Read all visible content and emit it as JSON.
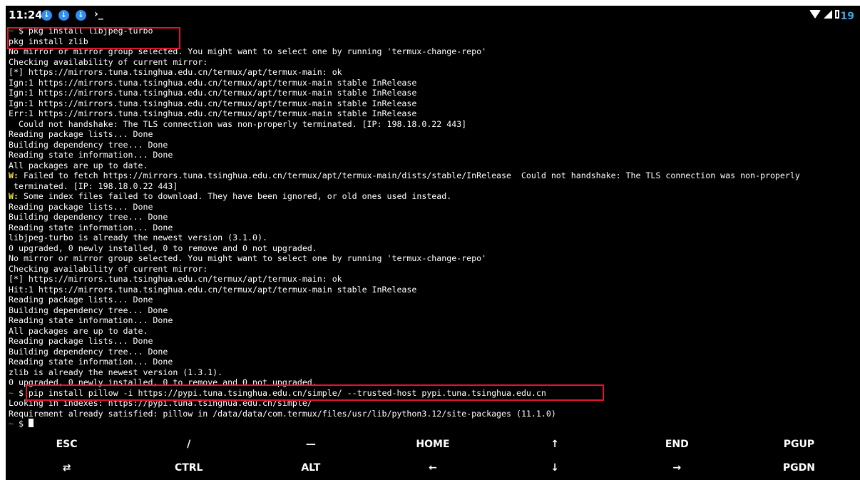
{
  "status_bar": {
    "time": "11:24",
    "notification_icons": [
      "download-icon",
      "download-icon",
      "download-icon"
    ],
    "terminal_glyph": "›_",
    "battery_level": "19",
    "colors": {
      "notif": "#2f8ff2",
      "battery_text": "#39a8e0"
    }
  },
  "terminal": {
    "lines": [
      {
        "prefix": "~ ",
        "text": "$ pkg install libjpeg-turbo"
      },
      {
        "text": "pkg install zlib"
      },
      {
        "text": "No mirror or mirror group selected. You might want to select one by running 'termux-change-repo'"
      },
      {
        "text": "Checking availability of current mirror:"
      },
      {
        "text": "[*] https://mirrors.tuna.tsinghua.edu.cn/termux/apt/termux-main: ok"
      },
      {
        "text": "Ign:1 https://mirrors.tuna.tsinghua.edu.cn/termux/apt/termux-main stable InRelease"
      },
      {
        "text": "Ign:1 https://mirrors.tuna.tsinghua.edu.cn/termux/apt/termux-main stable InRelease"
      },
      {
        "text": "Ign:1 https://mirrors.tuna.tsinghua.edu.cn/termux/apt/termux-main stable InRelease"
      },
      {
        "text": "Err:1 https://mirrors.tuna.tsinghua.edu.cn/termux/apt/termux-main stable InRelease"
      },
      {
        "text": "  Could not handshake: The TLS connection was non-properly terminated. [IP: 198.18.0.22 443]"
      },
      {
        "text": "Reading package lists... Done"
      },
      {
        "text": "Building dependency tree... Done"
      },
      {
        "text": "Reading state information... Done"
      },
      {
        "text": "All packages are up to date."
      },
      {
        "warn": "W:",
        "text": " Failed to fetch https://mirrors.tuna.tsinghua.edu.cn/termux/apt/termux-main/dists/stable/InRelease  Could not handshake: The TLS connection was non-properly"
      },
      {
        "text": " terminated. [IP: 198.18.0.22 443]"
      },
      {
        "warn": "W:",
        "text": " Some index files failed to download. They have been ignored, or old ones used instead."
      },
      {
        "text": "Reading package lists... Done"
      },
      {
        "text": "Building dependency tree... Done"
      },
      {
        "text": "Reading state information... Done"
      },
      {
        "text": "libjpeg-turbo is already the newest version (3.1.0)."
      },
      {
        "text": "0 upgraded, 0 newly installed, 0 to remove and 0 not upgraded."
      },
      {
        "text": "No mirror or mirror group selected. You might want to select one by running 'termux-change-repo'"
      },
      {
        "text": "Checking availability of current mirror:"
      },
      {
        "text": "[*] https://mirrors.tuna.tsinghua.edu.cn/termux/apt/termux-main: ok"
      },
      {
        "text": "Hit:1 https://mirrors.tuna.tsinghua.edu.cn/termux/apt/termux-main stable InRelease"
      },
      {
        "text": "Reading package lists... Done"
      },
      {
        "text": "Building dependency tree... Done"
      },
      {
        "text": "Reading state information... Done"
      },
      {
        "text": "All packages are up to date."
      },
      {
        "text": "Reading package lists... Done"
      },
      {
        "text": "Building dependency tree... Done"
      },
      {
        "text": "Reading state information... Done"
      },
      {
        "text": "zlib is already the newest version (1.3.1)."
      },
      {
        "text": "0 upgraded, 0 newly installed, 0 to remove and 0 not upgraded."
      },
      {
        "prefix": "~ ",
        "text": "$ pip install pillow -i https://pypi.tuna.tsinghua.edu.cn/simple/ --trusted-host pypi.tuna.tsinghua.edu.cn"
      },
      {
        "text": "Looking in indexes: https://pypi.tuna.tsinghua.edu.cn/simple/"
      },
      {
        "text": "Requirement already satisfied: pillow in /data/data/com.termux/files/usr/lib/python3.12/site-packages (11.1.0)"
      },
      {
        "prefix": "~ ",
        "text": "$ ",
        "cursor": true
      }
    ],
    "colors": {
      "background": "#000000",
      "foreground": "#ffffff",
      "prompt": "#3fbf3f",
      "warning": "#f2e23a",
      "highlight_box": "#e0162b"
    }
  },
  "extra_keys": {
    "row1": [
      "ESC",
      "/",
      "—",
      "HOME",
      "↑",
      "END",
      "PGUP"
    ],
    "row2": [
      "⇄",
      "CTRL",
      "ALT",
      "←",
      "↓",
      "→",
      "PGDN"
    ]
  }
}
